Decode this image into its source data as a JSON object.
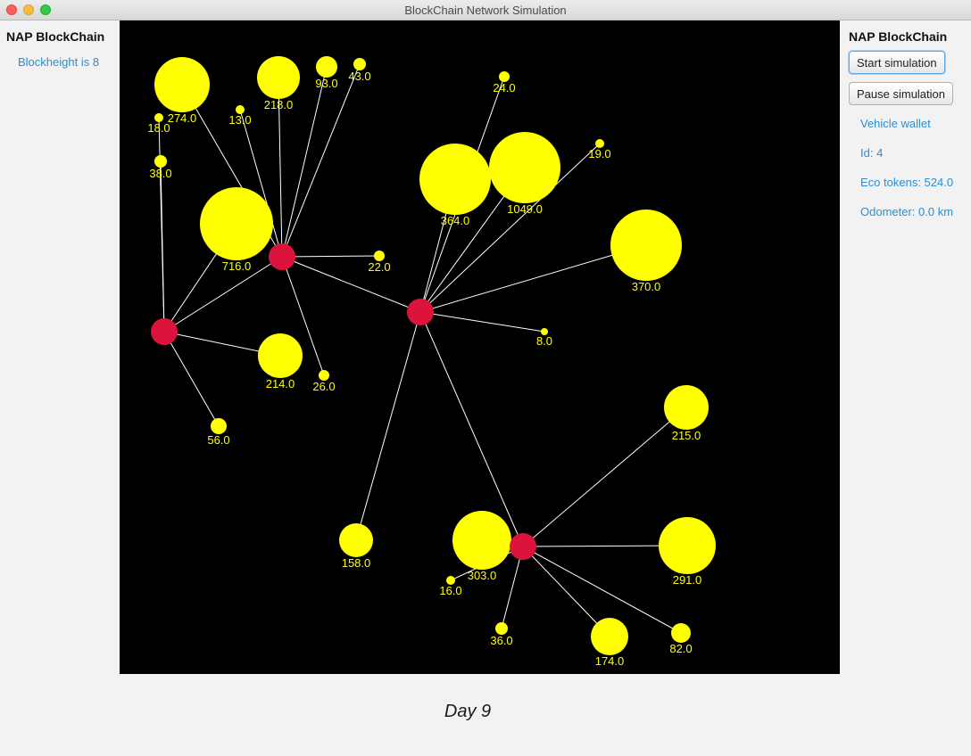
{
  "window": {
    "title": "BlockChain Network Simulation"
  },
  "left_panel": {
    "heading": "NAP BlockChain",
    "blockheight": "Blockheight is 8"
  },
  "right_panel": {
    "heading": "NAP BlockChain",
    "start_button": "Start simulation",
    "pause_button": "Pause simulation",
    "wallet_title": "Vehicle wallet",
    "wallet_id": "Id: 4",
    "wallet_tokens": "Eco tokens: 524.0",
    "wallet_odometer": "Odometer: 0.0 km"
  },
  "day_label": "Day 9",
  "colors": {
    "hub": "#dc143c",
    "vehicle": "#ffff00",
    "edge": "#ffffff",
    "background": "#000000",
    "link_text": "#2a8fcf"
  },
  "network": {
    "hubs": [
      "hub-a",
      "hub-b",
      "hub-c",
      "hub-d"
    ],
    "hub_links": [
      [
        "hub-b",
        "hub-a"
      ],
      [
        "hub-b",
        "hub-c"
      ],
      [
        "hub-c",
        "hub-d"
      ]
    ],
    "vehicles": [
      {
        "hub": "hub-a",
        "label": "716.0"
      },
      {
        "hub": "hub-a",
        "label": "18.0"
      },
      {
        "hub": "hub-a",
        "label": "38.0"
      },
      {
        "hub": "hub-a",
        "label": "214.0"
      },
      {
        "hub": "hub-a",
        "label": "56.0"
      },
      {
        "hub": "hub-b",
        "label": "274.0"
      },
      {
        "hub": "hub-b",
        "label": "13.0"
      },
      {
        "hub": "hub-b",
        "label": "218.0"
      },
      {
        "hub": "hub-b",
        "label": "93.0"
      },
      {
        "hub": "hub-b",
        "label": "43.0"
      },
      {
        "hub": "hub-b",
        "label": "22.0"
      },
      {
        "hub": "hub-b",
        "label": "26.0"
      },
      {
        "hub": "hub-c",
        "label": "24.0"
      },
      {
        "hub": "hub-c",
        "label": "364.0"
      },
      {
        "hub": "hub-c",
        "label": "1049.0"
      },
      {
        "hub": "hub-c",
        "label": "19.0"
      },
      {
        "hub": "hub-c",
        "label": "370.0"
      },
      {
        "hub": "hub-c",
        "label": "8.0"
      },
      {
        "hub": "hub-c",
        "label": "158.0"
      },
      {
        "hub": "hub-d",
        "label": "215.0"
      },
      {
        "hub": "hub-d",
        "label": "291.0"
      },
      {
        "hub": "hub-d",
        "label": "82.0"
      },
      {
        "hub": "hub-d",
        "label": "174.0"
      },
      {
        "hub": "hub-d",
        "label": "36.0"
      },
      {
        "hub": "hub-d",
        "label": "16.0"
      },
      {
        "hub": "hub-d",
        "label": "303.0"
      }
    ]
  }
}
